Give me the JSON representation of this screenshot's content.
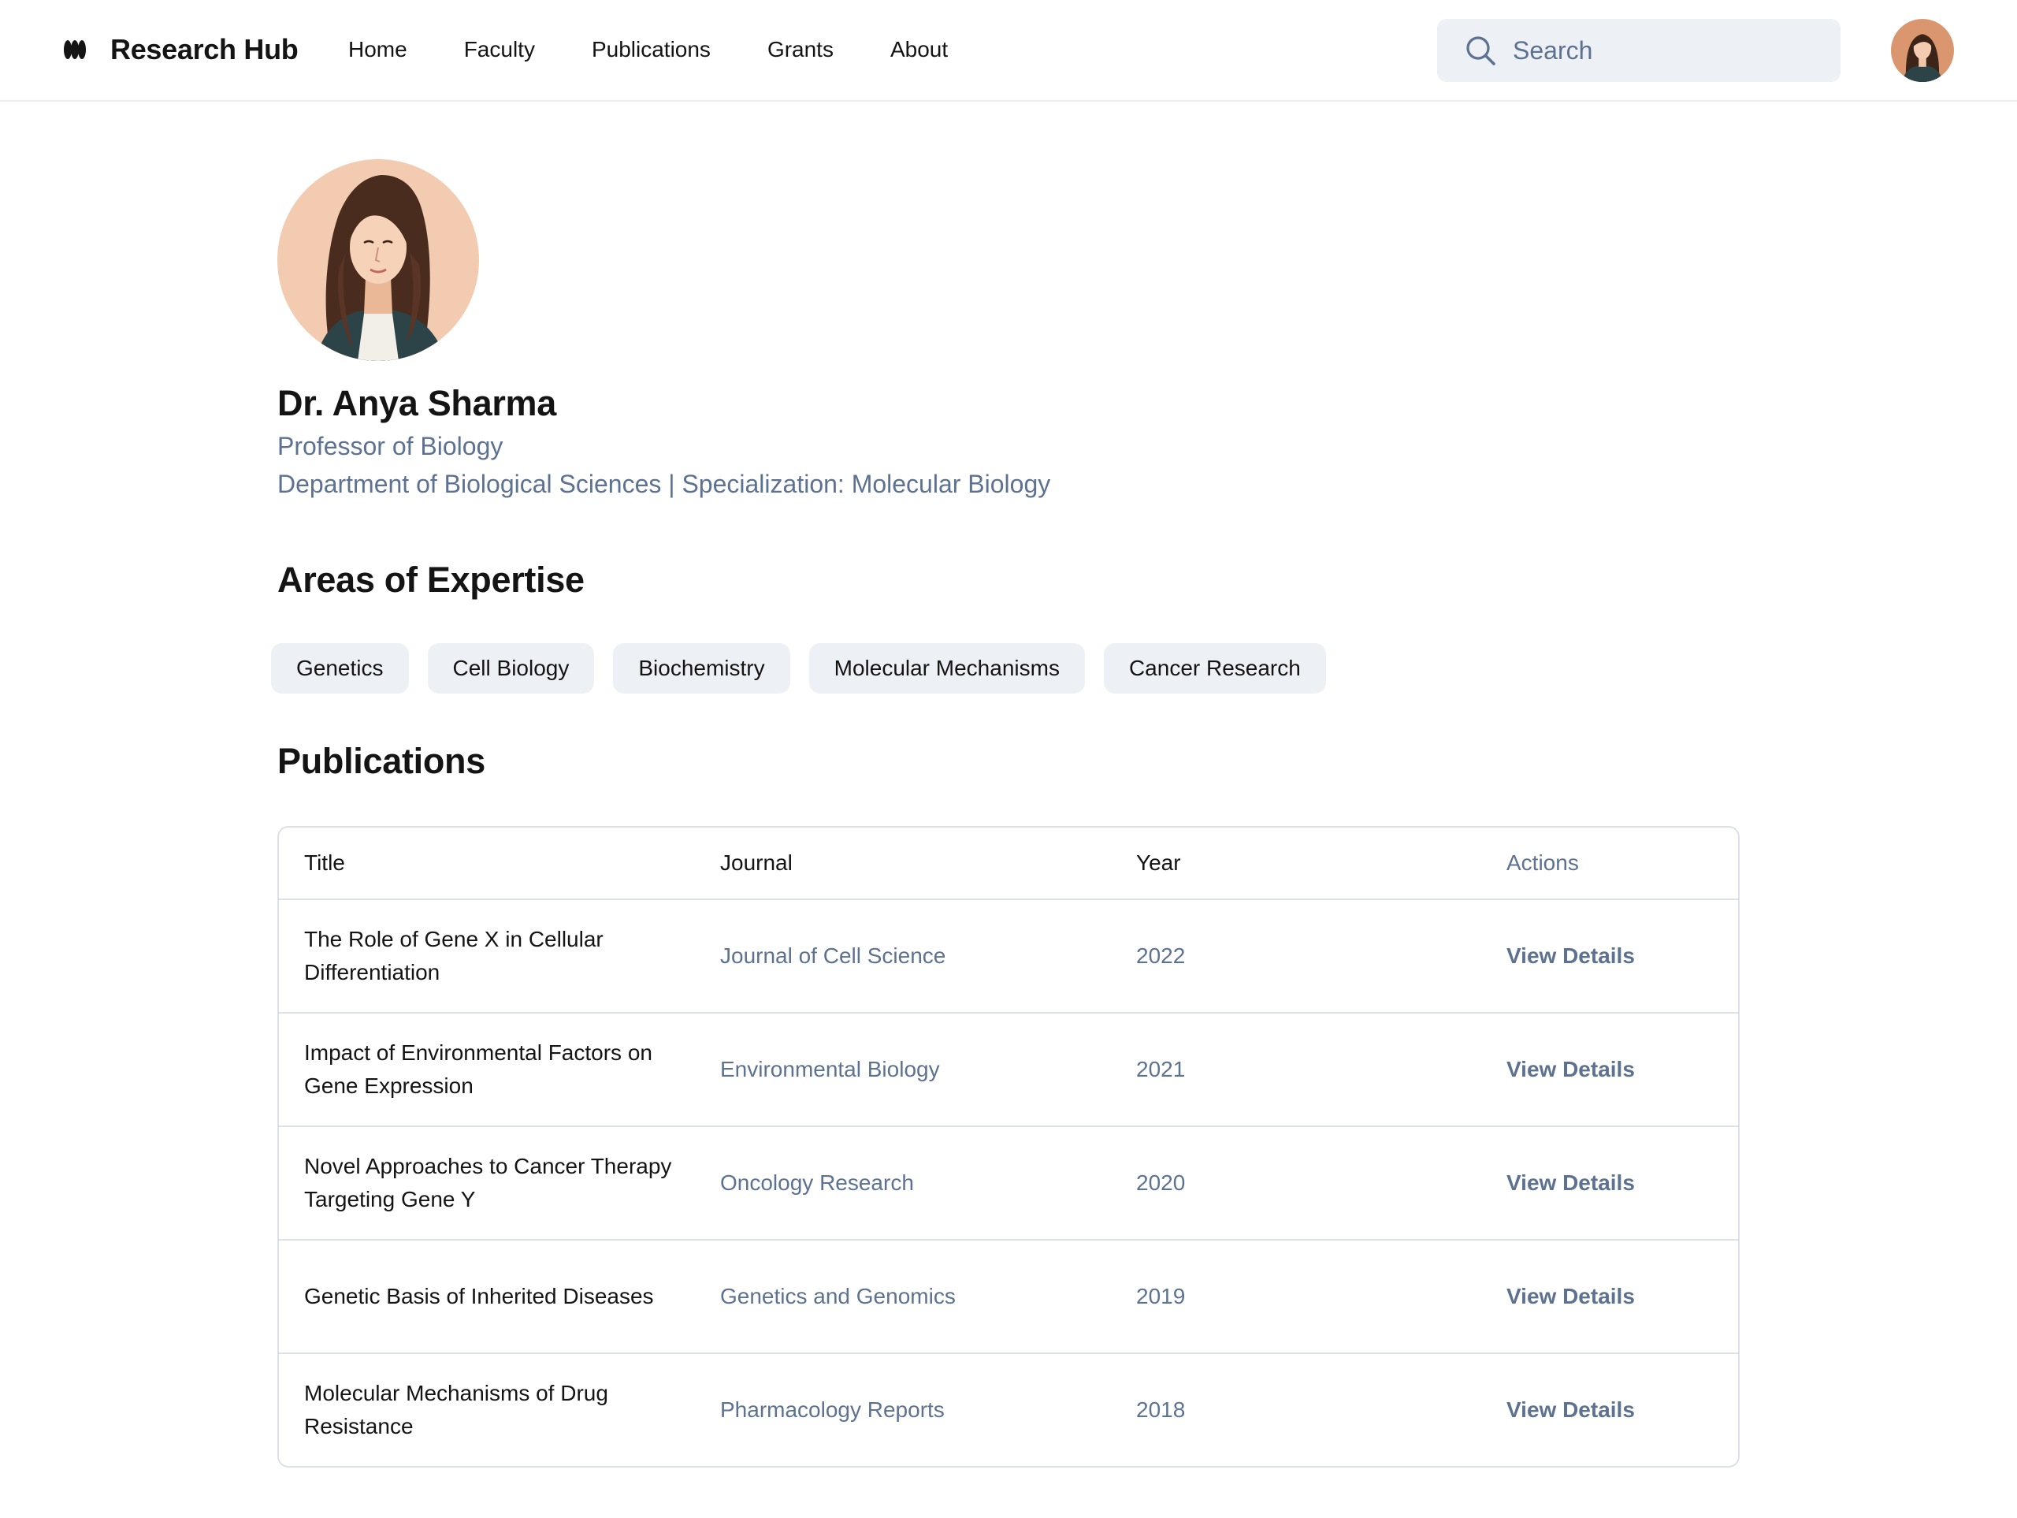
{
  "header": {
    "brand": "Research Hub",
    "nav": [
      "Home",
      "Faculty",
      "Publications",
      "Grants",
      "About"
    ],
    "search_placeholder": "Search"
  },
  "profile": {
    "name": "Dr. Anya Sharma",
    "title": "Professor of Biology",
    "department_line": "Department of Biological Sciences | Specialization: Molecular Biology"
  },
  "expertise": {
    "heading": "Areas of Expertise",
    "tags": [
      "Genetics",
      "Cell Biology",
      "Biochemistry",
      "Molecular Mechanisms",
      "Cancer Research"
    ]
  },
  "publications": {
    "heading": "Publications",
    "columns": [
      "Title",
      "Journal",
      "Year",
      "Actions"
    ],
    "rows": [
      {
        "title": "The Role of Gene X in Cellular Differentiation",
        "journal": "Journal of Cell Science",
        "year": "2022",
        "action": "View Details"
      },
      {
        "title": "Impact of Environmental Factors on Gene Expression",
        "journal": "Environmental Biology",
        "year": "2021",
        "action": "View Details"
      },
      {
        "title": "Novel Approaches to Cancer Therapy Targeting Gene Y",
        "journal": "Oncology Research",
        "year": "2020",
        "action": "View Details"
      },
      {
        "title": "Genetic Basis of Inherited Diseases",
        "journal": "Genetics and Genomics",
        "year": "2019",
        "action": "View Details"
      },
      {
        "title": "Molecular Mechanisms of Drug Resistance",
        "journal": "Pharmacology Reports",
        "year": "2018",
        "action": "View Details"
      }
    ]
  },
  "colors": {
    "text_primary": "#141414",
    "text_muted": "#5d7290",
    "chip_bg": "#edf0f4",
    "border": "#dde1e7",
    "avatar_bg": "#f3cbb0",
    "jacket": "#2c4448",
    "hair": "#4a2c1f"
  },
  "icons": [
    "brand-logo-icon",
    "search-icon",
    "user-avatar"
  ]
}
